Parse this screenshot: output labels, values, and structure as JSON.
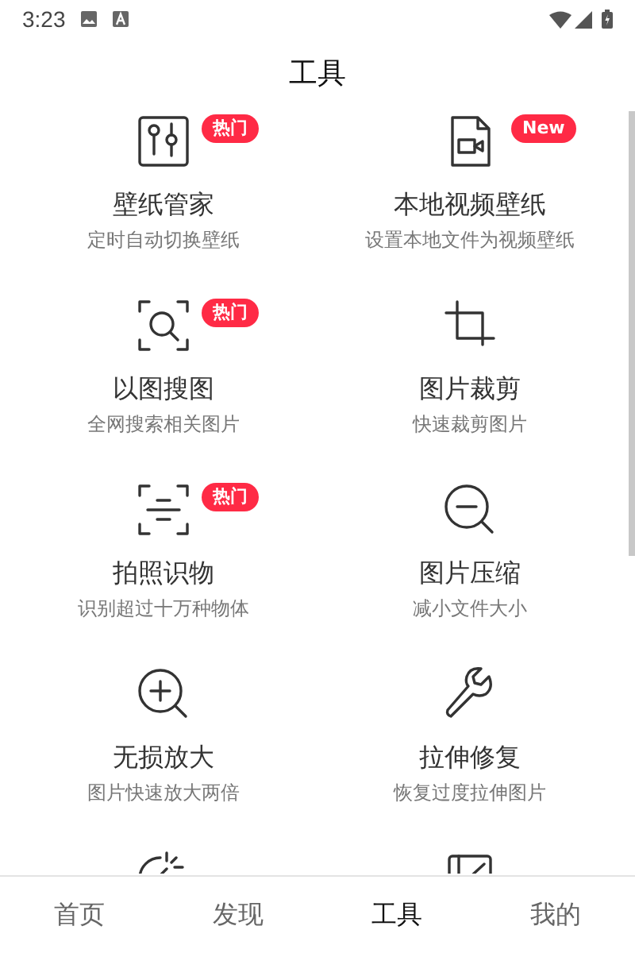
{
  "status_bar": {
    "time": "3:23"
  },
  "header": {
    "title": "工具"
  },
  "tools": [
    {
      "title": "壁纸管家",
      "subtitle": "定时自动切换壁纸",
      "badge": "热门"
    },
    {
      "title": "本地视频壁纸",
      "subtitle": "设置本地文件为视频壁纸",
      "badge": "New"
    },
    {
      "title": "以图搜图",
      "subtitle": "全网搜索相关图片",
      "badge": "热门"
    },
    {
      "title": "图片裁剪",
      "subtitle": "快速裁剪图片"
    },
    {
      "title": "拍照识物",
      "subtitle": "识别超过十万种物体",
      "badge": "热门"
    },
    {
      "title": "图片压缩",
      "subtitle": "减小文件大小"
    },
    {
      "title": "无损放大",
      "subtitle": "图片快速放大两倍"
    },
    {
      "title": "拉伸修复",
      "subtitle": "恢复过度拉伸图片"
    }
  ],
  "bottom_nav": [
    {
      "label": "首页",
      "selected": false
    },
    {
      "label": "发现",
      "selected": false
    },
    {
      "label": "工具",
      "selected": true
    },
    {
      "label": "我的",
      "selected": false
    }
  ]
}
